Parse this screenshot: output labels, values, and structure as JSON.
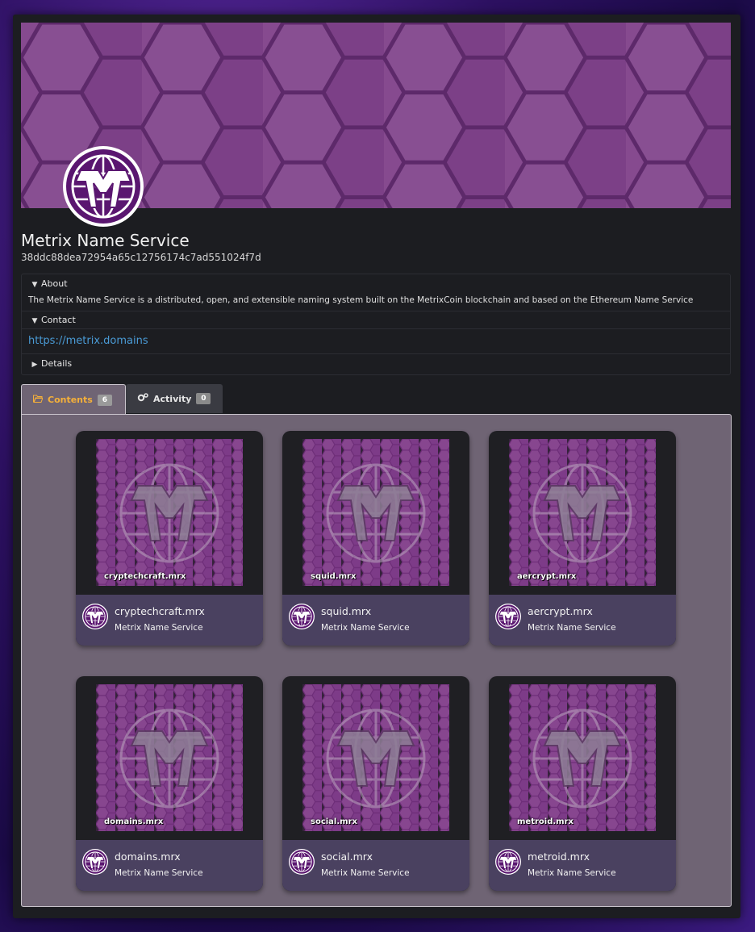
{
  "profile": {
    "title": "Metrix Name Service",
    "address": "38ddc88dea72954a65c12756174c7ad551024f7d"
  },
  "sections": {
    "about_label": "About",
    "about_text": "The Metrix Name Service is a distributed, open, and extensible naming system built on the MetrixCoin blockchain and based on the Ethereum Name Service",
    "contact_label": "Contact",
    "contact_link": "https://metrix.domains",
    "details_label": "Details"
  },
  "tabs": [
    {
      "label": "Contents",
      "count": "6",
      "icon": "folder-open-icon"
    },
    {
      "label": "Activity",
      "count": "0",
      "icon": "cogs-icon"
    }
  ],
  "items": [
    {
      "name": "cryptechcraft.mrx",
      "owner": "Metrix Name Service"
    },
    {
      "name": "squid.mrx",
      "owner": "Metrix Name Service"
    },
    {
      "name": "aercrypt.mrx",
      "owner": "Metrix Name Service"
    },
    {
      "name": "domains.mrx",
      "owner": "Metrix Name Service"
    },
    {
      "name": "social.mrx",
      "owner": "Metrix Name Service"
    },
    {
      "name": "metroid.mrx",
      "owner": "Metrix Name Service"
    }
  ],
  "colors": {
    "brand_purple": "#8a4f92",
    "accent_tab": "#f4b03a",
    "link": "#4a9bd6"
  }
}
